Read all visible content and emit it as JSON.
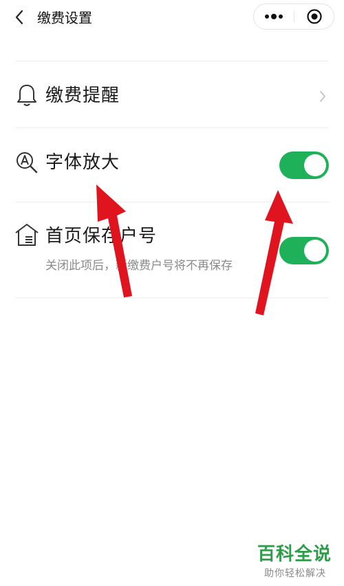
{
  "nav": {
    "title": "缴费设置",
    "back_icon": "chevron-left-icon",
    "more_icon": "more-dots-icon",
    "close_icon": "mini-program-close-icon"
  },
  "settings": {
    "reminder": {
      "label": "缴费提醒",
      "icon": "bell-icon",
      "action": "chevron-right-icon"
    },
    "font_enlarge": {
      "label": "字体放大",
      "icon": "font-magnifier-icon",
      "enabled": true
    },
    "save_account": {
      "label": "首页保存户号",
      "sublabel": "关闭此项后，新缴费户号将不再保存",
      "icon": "house-icon",
      "enabled": true
    }
  },
  "colors": {
    "toggle_on": "#1fb15a",
    "arrow": "#e0141e",
    "watermark": "#2f9c4a"
  },
  "watermark": {
    "title": "百科全说",
    "subtitle": "助你轻松解决"
  }
}
